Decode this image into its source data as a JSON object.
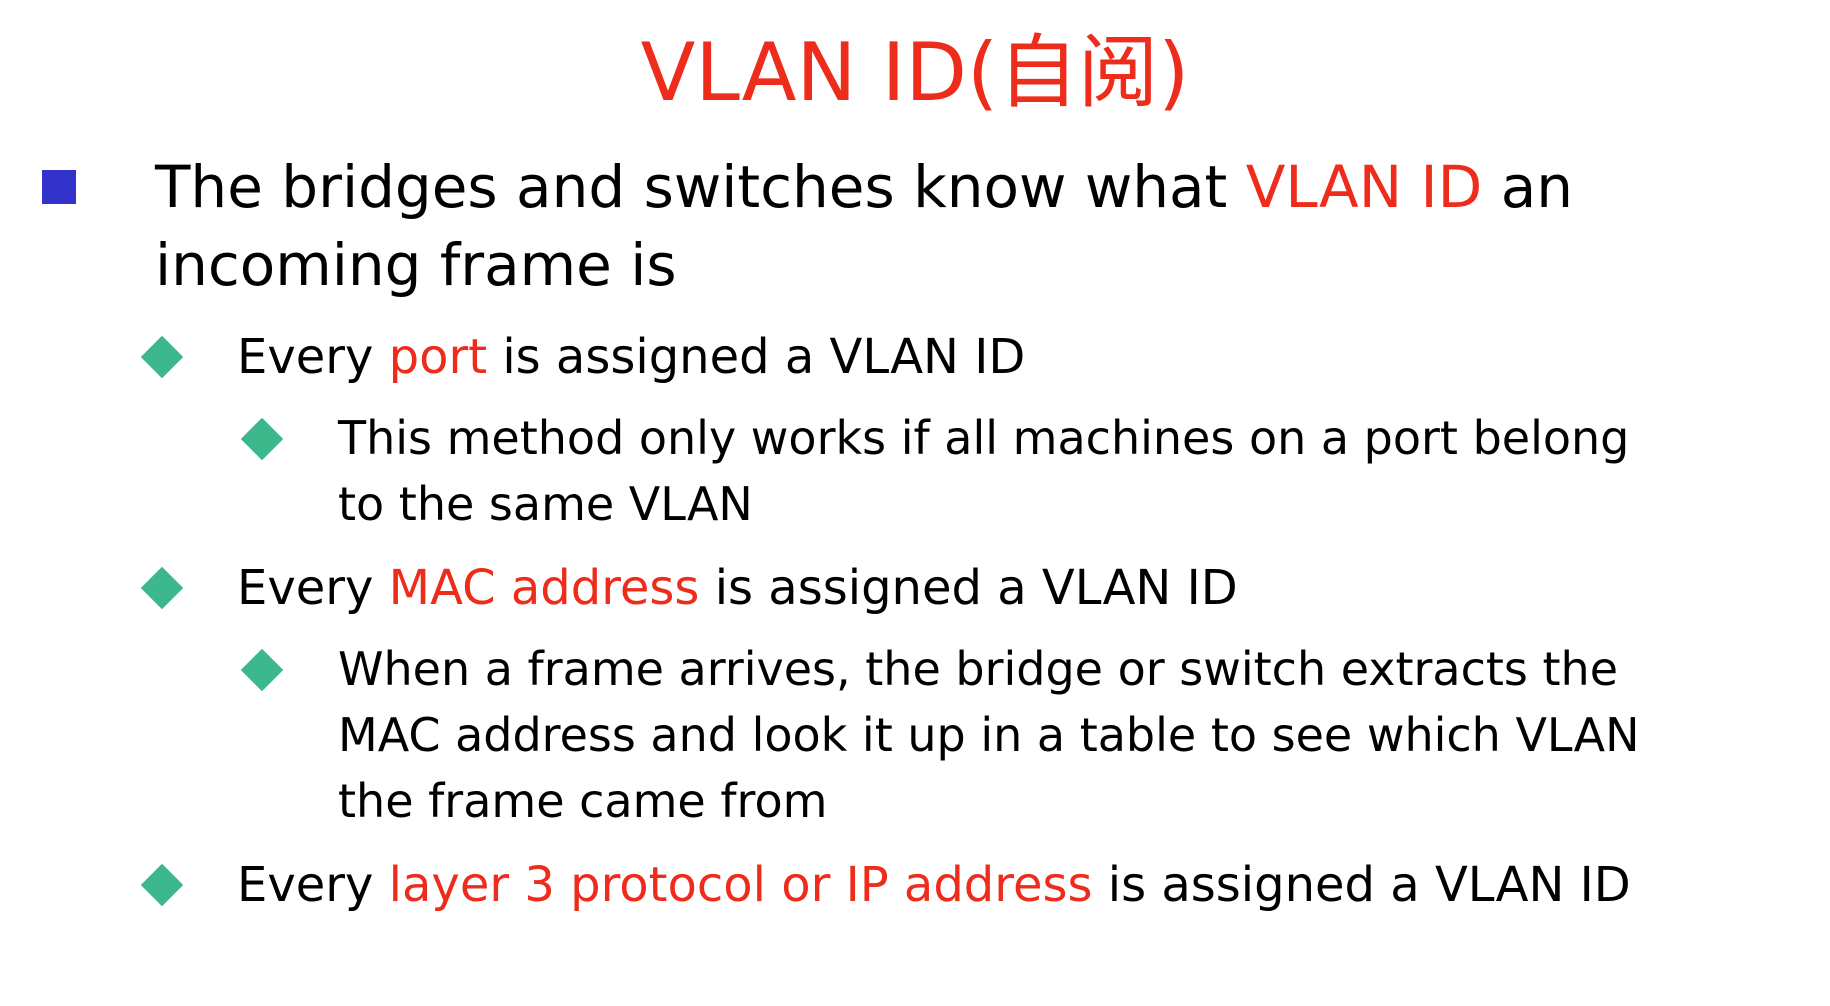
{
  "colors": {
    "accent": "#ee2c1c",
    "square_bullet": "#3333cc",
    "diamond_bullet": "#3cb88c",
    "text": "#000000"
  },
  "title": "VLAN ID(自阅)",
  "main_bullet": {
    "line1": {
      "pre": "The bridges and switches know what ",
      "highlight": "VLAN ID",
      "post": " an"
    },
    "line2": "incoming frame is"
  },
  "items": [
    {
      "pre": "Every ",
      "highlight": "port",
      "post": " is assigned a VLAN ID",
      "sub": {
        "lines": [
          "This method only works if all machines on a port belong",
          "to the same VLAN"
        ]
      }
    },
    {
      "pre": "Every ",
      "highlight": "MAC address",
      "post": " is assigned a VLAN ID",
      "sub": {
        "lines": [
          "When a frame arrives, the bridge or switch extracts the",
          "MAC address and look it up in a table to see which VLAN",
          "the frame came from"
        ]
      }
    },
    {
      "pre": "Every ",
      "highlight": "layer 3 protocol or IP address",
      "post": " is assigned a VLAN ID"
    }
  ]
}
